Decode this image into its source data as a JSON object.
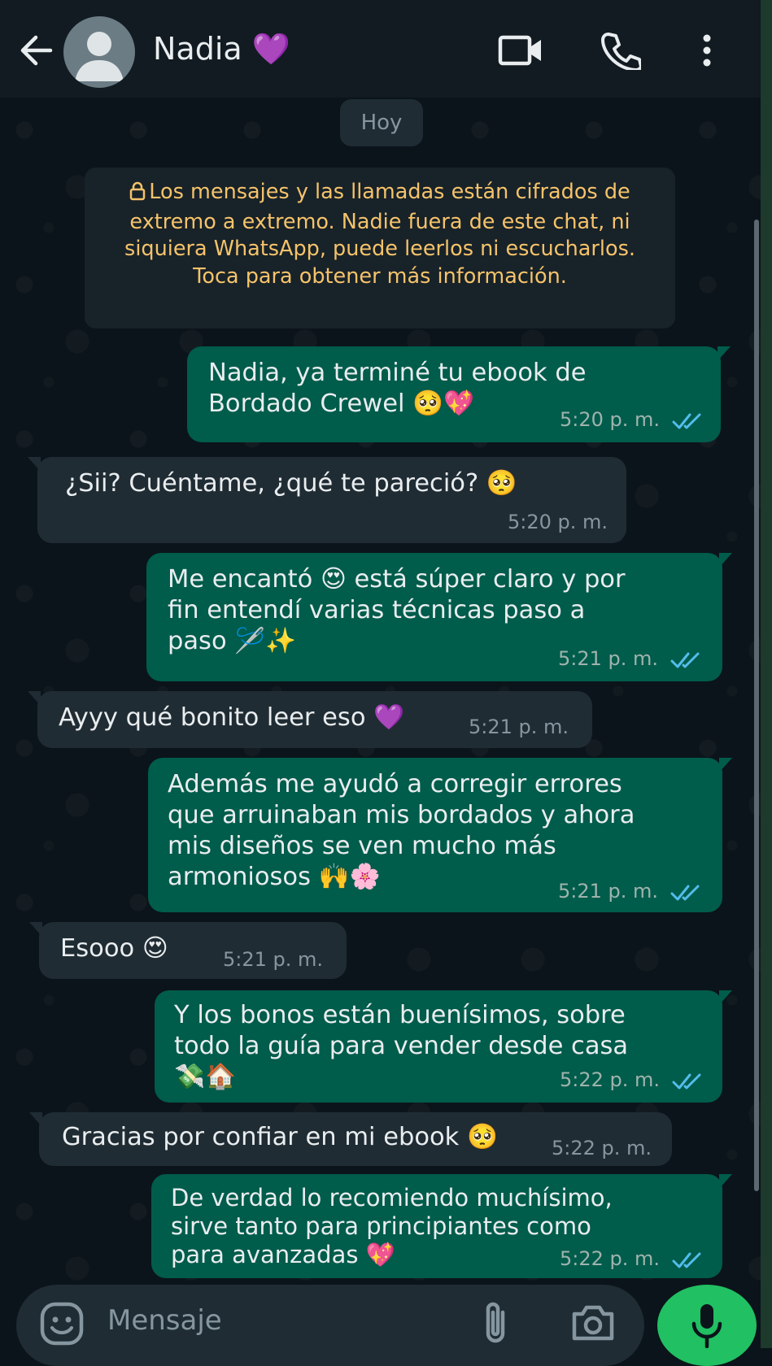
{
  "header": {
    "contact_name": "Nadia 💜",
    "icons": [
      "back-arrow-icon",
      "avatar-icon",
      "video-call-icon",
      "phone-icon",
      "more-options-icon"
    ]
  },
  "chat": {
    "date_chip": "Hoy",
    "encryption_notice": "Los mensajes y las llamadas están cifrados de extremo a extremo. Nadie fuera de este chat, ni siquiera WhatsApp, puede leerlos ni escucharlos. Toca para obtener más información.",
    "messages": [
      {
        "direction": "outgoing",
        "text": "Nadia, ya terminé tu ebook de\nBordado Crewel 🥺💖",
        "time": "5:20 p. m.",
        "read": true
      },
      {
        "direction": "incoming",
        "text": "¿Sii? Cuéntame, ¿qué te pareció? 🥺",
        "time": "5:20 p. m."
      },
      {
        "direction": "outgoing",
        "text": "Me encantó 😍 está súper claro y por\nfin entendí varias técnicas paso a\npaso 🪡✨",
        "time": "5:21 p. m.",
        "read": true
      },
      {
        "direction": "incoming",
        "text": "Ayyy qué bonito leer eso 💜",
        "time": "5:21 p. m."
      },
      {
        "direction": "outgoing",
        "text": "Además me ayudó a corregir errores\nque arruinaban mis bordados y ahora\nmis diseños se ven mucho más\narmoniosos 🙌🌸",
        "time": "5:21 p. m.",
        "read": true
      },
      {
        "direction": "incoming",
        "text": "Esooo 😍",
        "time": "5:21 p. m."
      },
      {
        "direction": "outgoing",
        "text": "Y los bonos están buenísimos, sobre\ntodo la guía para vender desde casa\n💸🏠",
        "time": "5:22 p. m.",
        "read": true
      },
      {
        "direction": "incoming",
        "text": "Gracias por confiar en mi ebook 🥺",
        "time": "5:22 p. m."
      },
      {
        "direction": "outgoing",
        "text": "De verdad lo recomiendo muchísimo,\nsirve tanto para principiantes como\npara avanzadas 💖",
        "time": "5:22 p. m.",
        "read": true
      }
    ]
  },
  "composer": {
    "placeholder": "Mensaje",
    "icons": [
      "emoji-icon",
      "attach-icon",
      "camera-icon",
      "mic-icon"
    ]
  },
  "colors": {
    "background": "#0b141a",
    "header": "#111b21",
    "outgoing_bubble": "#005c4b",
    "incoming_bubble": "#202c33",
    "notice_text": "#f5c36a",
    "read_ticks": "#53bdeb",
    "mic_button": "#21c063"
  }
}
